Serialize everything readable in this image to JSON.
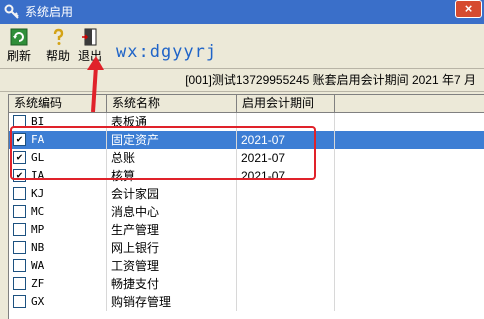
{
  "window": {
    "title": "系统启用",
    "close_glyph": "×"
  },
  "toolbar": {
    "refresh_label": "刷新",
    "help_label": "帮助",
    "exit_label": "退出"
  },
  "watermark": "wx:dgyyrj",
  "info": "[001]测试13729955245 账套启用会计期间 2021 年7 月",
  "table": {
    "headers": [
      "系统编码",
      "系统名称",
      "启用会计期间"
    ],
    "rows": [
      {
        "code": "BI",
        "name": "表板通",
        "period": "",
        "checked": false,
        "selected": false
      },
      {
        "code": "FA",
        "name": "固定资产",
        "period": "2021-07",
        "checked": true,
        "selected": true
      },
      {
        "code": "GL",
        "name": "总账",
        "period": "2021-07",
        "checked": true,
        "selected": false
      },
      {
        "code": "IA",
        "name": "核算",
        "period": "2021-07",
        "checked": true,
        "selected": false
      },
      {
        "code": "KJ",
        "name": "会计家园",
        "period": "",
        "checked": false,
        "selected": false
      },
      {
        "code": "MC",
        "name": "消息中心",
        "period": "",
        "checked": false,
        "selected": false
      },
      {
        "code": "MP",
        "name": "生产管理",
        "period": "",
        "checked": false,
        "selected": false
      },
      {
        "code": "NB",
        "name": "网上银行",
        "period": "",
        "checked": false,
        "selected": false
      },
      {
        "code": "WA",
        "name": "工资管理",
        "period": "",
        "checked": false,
        "selected": false
      },
      {
        "code": "ZF",
        "name": "畅捷支付",
        "period": "",
        "checked": false,
        "selected": false
      },
      {
        "code": "GX",
        "name": "购销存管理",
        "period": "",
        "checked": false,
        "selected": false
      }
    ]
  },
  "colors": {
    "titlebar": "#3a6fc9",
    "selection": "#3d7ed4",
    "annotation": "#e0222a",
    "watermark": "#1f64c8"
  }
}
